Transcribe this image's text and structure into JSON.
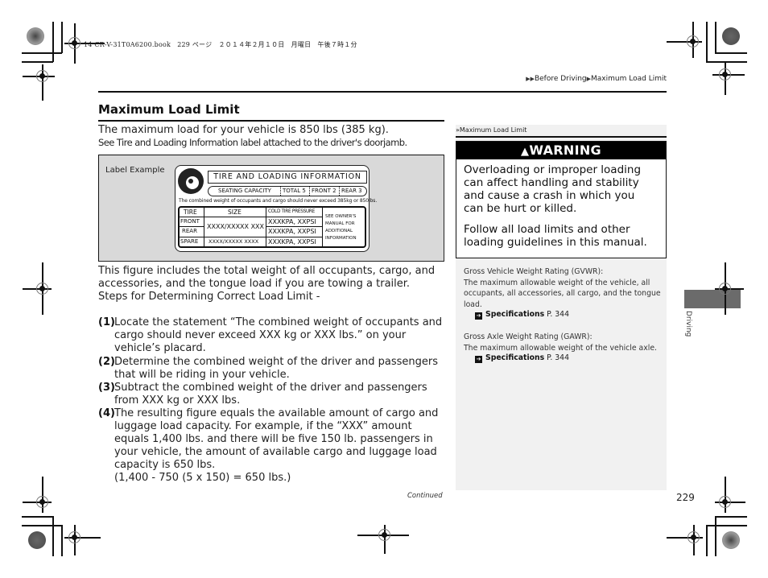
{
  "print_header": {
    "meta": "14 CR-V-31T0A6200.book　229 ページ　２０１４年２月１０日　月曜日　午後７時１分"
  },
  "breadcrumb": {
    "arrows": "▶▶",
    "items": [
      "Before Driving",
      "Maximum Load Limit"
    ],
    "separator": "▶"
  },
  "main": {
    "title": "Maximum Load Limit",
    "intro_line1": "The maximum load for your vehicle is 850 lbs (385 kg).",
    "intro_line2": "See Tire and Loading Information label attached to the driver's doorjamb.",
    "figure": {
      "caption": "Label Example",
      "label": {
        "title": "TIRE AND LOADING INFORMATION",
        "seating_capacity": "SEATING CAPACITY",
        "total": "TOTAL 5",
        "front": "FRONT 2",
        "rear": "REAR 3",
        "combined_text": "The combined weight of occupants and cargo should never exceed 385kg or 850lbs.",
        "table_headers": [
          "TIRE",
          "SIZE",
          "COLD TIRE PRESSURE"
        ],
        "rows": [
          {
            "tire": "FRONT",
            "pressure": "XXXKPA, XXPSI"
          },
          {
            "tire": "REAR",
            "pressure": "XXXKPA, XXPSI"
          },
          {
            "tire": "SPARE",
            "size": "XXXX/XXXXX XXXX",
            "pressure": "XXXKPA, XXPSI"
          }
        ],
        "front_rear_size": "XXXX/XXXXX XXX",
        "note_lines": [
          "SEE OWNER'S",
          "MANUAL FOR",
          "ADDITIONAL",
          "INFORMATION"
        ]
      }
    },
    "paragraph_lines": [
      "This figure includes the total weight of all occupants, cargo, and",
      "accessories, and the tongue load if you are towing a trailer.",
      "Steps for Determining Correct Load Limit -"
    ],
    "steps": [
      {
        "num": "(1)",
        "lines": [
          "Locate the statement “The combined weight of occupants and",
          "cargo should never exceed XXX kg or XXX lbs.” on your",
          "vehicle’s placard."
        ]
      },
      {
        "num": "(2)",
        "lines": [
          "Determine the combined weight of the driver and passengers",
          "that will be riding in your vehicle."
        ]
      },
      {
        "num": "(3)",
        "lines": [
          "Subtract the combined weight of the driver and passengers",
          "from XXX kg or XXX lbs."
        ]
      },
      {
        "num": "(4)",
        "lines": [
          "The resulting figure equals the available amount of cargo and",
          "luggage load capacity. For example, if the “XXX” amount",
          "equals 1,400 lbs. and there will be five 150 lb. passengers in",
          "your vehicle, the amount of available cargo and luggage load",
          "capacity is 650 lbs.",
          "(1,400 - 750 (5 x 150) = 650 lbs.)"
        ]
      }
    ],
    "continued": "Continued"
  },
  "sidebar": {
    "ref_icon": "»",
    "ref_title": "Maximum Load Limit",
    "warning": {
      "label": "WARNING",
      "icon": "▲",
      "para1": [
        "Overloading or improper loading",
        "can affect handling and stability",
        "and cause a crash in which you",
        "can be hurt or killed."
      ],
      "para2": [
        "Follow all load limits and other",
        "loading guidelines in this manual."
      ]
    },
    "gvwr": {
      "heading": "Gross Vehicle Weight Rating (GVWR):",
      "lines": [
        "The maximum allowable weight of the vehicle, all",
        "occupants, all accessories, all cargo, and the tongue",
        "load."
      ],
      "link_label": "Specifications",
      "link_page": "P. 344"
    },
    "gawr": {
      "heading": "Gross Axle Weight Rating (GAWR):",
      "lines": [
        "The maximum allowable weight of the vehicle axle."
      ],
      "link_label": "Specifications",
      "link_page": "P. 344"
    },
    "link_icon": "➔"
  },
  "section_tab": "Driving",
  "page_number": "229"
}
